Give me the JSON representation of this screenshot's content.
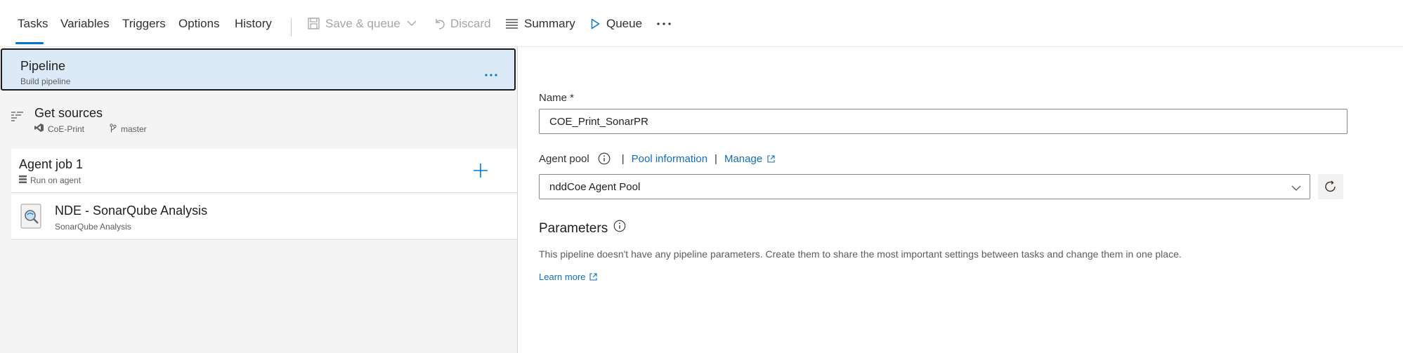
{
  "toolbar": {
    "tabs": [
      {
        "label": "Tasks",
        "active": true
      },
      {
        "label": "Variables"
      },
      {
        "label": "Triggers"
      },
      {
        "label": "Options"
      },
      {
        "label": "History"
      }
    ],
    "save_queue_label": "Save & queue",
    "discard_label": "Discard",
    "summary_label": "Summary",
    "queue_label": "Queue",
    "more_icon": "ellipsis-icon"
  },
  "left": {
    "pipeline": {
      "title": "Pipeline",
      "subtitle": "Build pipeline"
    },
    "get_sources": {
      "title": "Get sources",
      "repo": "CoE-Print",
      "branch": "master"
    },
    "agent_job": {
      "title": "Agent job 1",
      "subtitle": "Run on agent"
    },
    "task": {
      "title": "NDE - SonarQube Analysis",
      "subtitle": "SonarQube Analysis"
    }
  },
  "right": {
    "name_label": "Name *",
    "name_value": "COE_Print_SonarPR",
    "agent_pool_label": "Agent pool",
    "pool_information_link": "Pool information",
    "manage_link": "Manage",
    "separator": "|",
    "agent_pool_value": "nddCoe Agent Pool",
    "parameters_title": "Parameters",
    "parameters_desc": "This pipeline doesn't have any pipeline parameters. Create them to share the most important settings between tasks and change them in one place.",
    "learn_more": "Learn more"
  },
  "colors": {
    "accent": "#0078d4",
    "link": "#106ebe",
    "selected_row": "#dceaf7",
    "panel_bg": "#f4f4f4"
  }
}
